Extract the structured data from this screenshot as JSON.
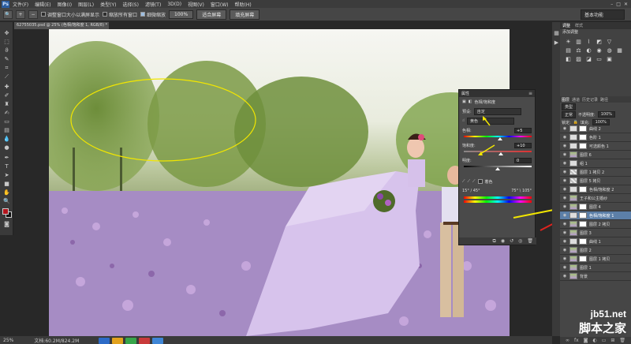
{
  "app": {
    "logo": "Ps",
    "menus": [
      "文件(F)",
      "编辑(E)",
      "图像(I)",
      "图层(L)",
      "类型(Y)",
      "选择(S)",
      "滤镜(T)",
      "3D(D)",
      "视图(V)",
      "窗口(W)",
      "帮助(H)"
    ]
  },
  "options": {
    "check_resize_windows": "调整窗口大小以满屏显示",
    "check_zoom_all": "缩放所有窗口",
    "check_scrubby": "细微缩放",
    "btn_100": "100%",
    "btn_fit": "适合屏幕",
    "btn_fill": "填充屏幕",
    "workspace": "基本功能"
  },
  "document": {
    "tab": "62755035.psd @ 25% (色相/饱和度 1, RGB/8) *"
  },
  "status": {
    "zoom": "25%",
    "doc_size": "文档:60.2M/824.2M"
  },
  "panels": {
    "tab_adjust": "调整",
    "tab_style": "样式",
    "adjust_title": "添加调整",
    "layers_tabs": [
      "图层",
      "通道",
      "历史记录",
      "路径"
    ],
    "kind": "类型",
    "blend": "正常",
    "opacity_label": "不透明度:",
    "opacity": "100%",
    "lock_label": "锁定:",
    "fill_label": "填充:",
    "fill": "100%"
  },
  "layers": [
    {
      "name": "曲线 2",
      "thumb": "adj",
      "mask": true
    },
    {
      "name": "色阶 1",
      "thumb": "adj",
      "mask": true
    },
    {
      "name": "可选颜色 1",
      "thumb": "adj",
      "mask": true
    },
    {
      "name": "图层 6",
      "thumb": "img",
      "mask": false
    },
    {
      "name": "组 1",
      "thumb": "group",
      "mask": false
    },
    {
      "name": "图层 1 拷贝 2",
      "thumb": "check",
      "mask": false
    },
    {
      "name": "图层 5 拷贝",
      "thumb": "check",
      "mask": false
    },
    {
      "name": "色相/饱和度 2",
      "thumb": "adj",
      "mask": true
    },
    {
      "name": "王子和公主婚纱",
      "thumb": "img",
      "mask": false
    },
    {
      "name": "图层 4",
      "thumb": "img",
      "mask": true
    },
    {
      "name": "色相/饱和度 1",
      "thumb": "adj",
      "mask": true,
      "selected": true
    },
    {
      "name": "图层 2 拷贝",
      "thumb": "img",
      "mask": true
    },
    {
      "name": "图层 3",
      "thumb": "img",
      "mask": false
    },
    {
      "name": "曲线 1",
      "thumb": "adj",
      "mask": true
    },
    {
      "name": "图层 2",
      "thumb": "img",
      "mask": false
    },
    {
      "name": "图层 1 拷贝",
      "thumb": "img",
      "mask": true
    },
    {
      "name": "图层 1",
      "thumb": "img",
      "mask": false
    },
    {
      "name": "背景",
      "thumb": "img",
      "mask": false
    }
  ],
  "properties": {
    "tab": "属性",
    "title": "色相/饱和度",
    "preset_label": "预设:",
    "preset": "自定",
    "channel": "黄色",
    "hue_label": "色相:",
    "hue": "+5",
    "hue_fraction": 0.53,
    "sat_label": "饱和度:",
    "sat": "+10",
    "sat_fraction": 0.55,
    "light_label": "明度:",
    "light": "0",
    "light_fraction": 0.5,
    "colorize": "着色",
    "range_left": "15° / 45°",
    "range_right": "75° \\ 105°"
  },
  "watermark": {
    "url": "jb51.net",
    "cn": "脚本之家"
  },
  "colors": {
    "fg": "#b3141c",
    "bg": "#111111",
    "annotation_yellow": "#f2e600",
    "annotation_red": "#e0231e"
  }
}
